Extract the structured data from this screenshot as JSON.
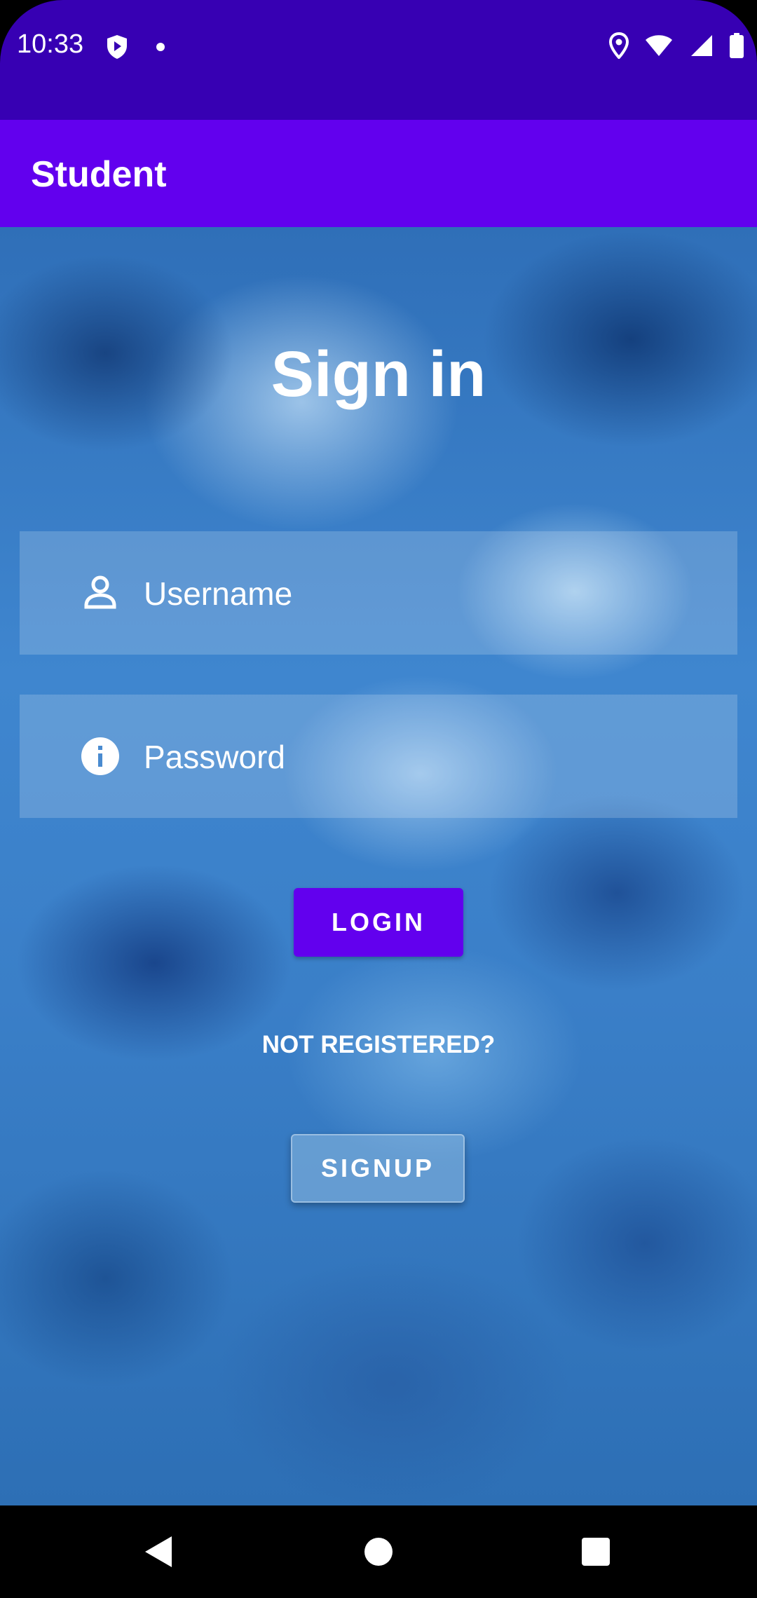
{
  "status_bar": {
    "time": "10:33"
  },
  "app_bar": {
    "title": "Student"
  },
  "main": {
    "title": "Sign in",
    "username": {
      "placeholder": "Username",
      "value": "",
      "icon": "person-icon"
    },
    "password": {
      "placeholder": "Password",
      "value": "",
      "icon": "info-icon"
    },
    "login_label": "LOGIN",
    "not_registered_text": "NOT REGISTERED?",
    "signup_label": "SIGNUP"
  },
  "colors": {
    "status_bar": "#3700B3",
    "app_bar": "#6200EE",
    "primary_button": "#6200EE",
    "text": "#FFFFFF"
  },
  "navigation": {
    "icons": [
      "back-icon",
      "home-icon",
      "recents-icon"
    ]
  }
}
